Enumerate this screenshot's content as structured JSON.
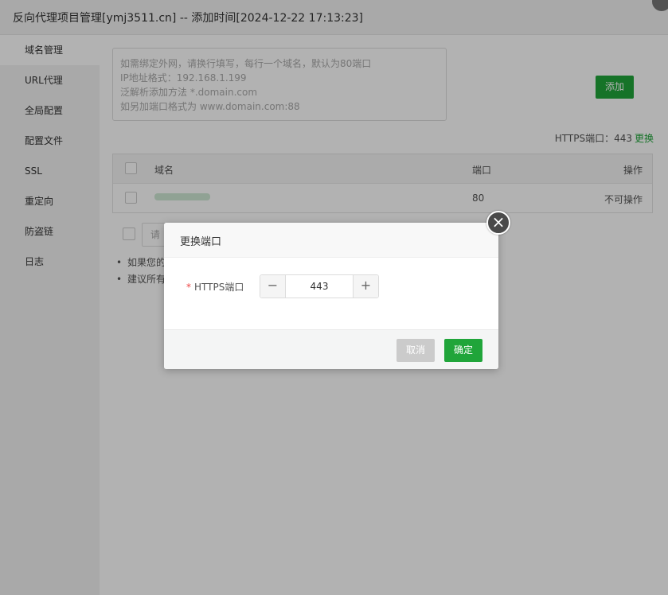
{
  "window": {
    "title": "反向代理项目管理[ymj3511.cn] -- 添加时间[2024-12-22 17:13:23]"
  },
  "sidebar": {
    "items": [
      {
        "label": "域名管理",
        "active": true
      },
      {
        "label": "URL代理",
        "active": false
      },
      {
        "label": "全局配置",
        "active": false
      },
      {
        "label": "配置文件",
        "active": false
      },
      {
        "label": "SSL",
        "active": false
      },
      {
        "label": "重定向",
        "active": false
      },
      {
        "label": "防盗链",
        "active": false
      },
      {
        "label": "日志",
        "active": false
      }
    ]
  },
  "main": {
    "domain_input": {
      "placeholder_lines": [
        "如需绑定外网，请换行填写，每行一个域名，默认为80端口",
        "IP地址格式：192.168.1.199",
        "泛解析添加方法 *.domain.com",
        "如另加端口格式为 www.domain.com:88"
      ]
    },
    "add_button": "添加",
    "https_port": {
      "label": "HTTPS端口：443",
      "change_link": "更换"
    },
    "table": {
      "headers": [
        "域名",
        "端口",
        "操作"
      ],
      "rows": [
        {
          "domain": "",
          "port": "80",
          "action": "不可操作"
        }
      ]
    },
    "footer_select_placeholder": "请",
    "tips": [
      "如果您的",
      "建议所有"
    ]
  },
  "dialog": {
    "title": "更换端口",
    "field_label": "HTTPS端口",
    "required_mark": "*",
    "value": "443",
    "minus": "−",
    "plus": "+",
    "cancel": "取消",
    "confirm": "确定",
    "close_glyph": "×"
  },
  "colors": {
    "accent": "#20a53a",
    "overlay": "rgba(0,0,0,0.3)",
    "required": "#e44444"
  }
}
